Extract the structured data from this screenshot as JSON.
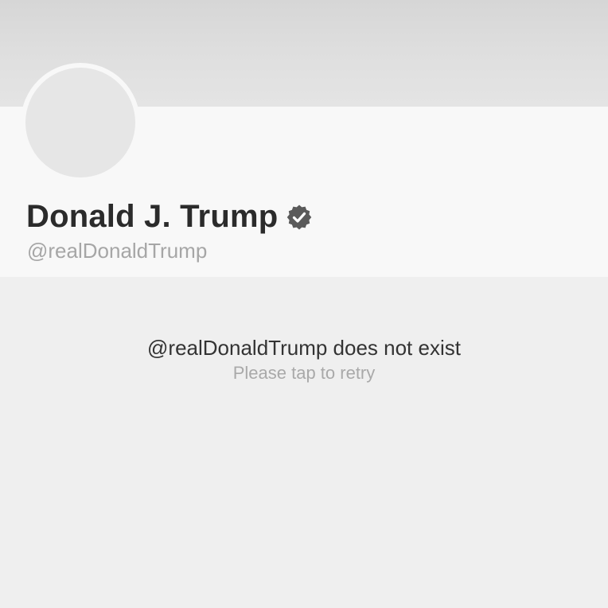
{
  "profile": {
    "display_name": "Donald J. Trump",
    "handle": "@realDonaldTrump",
    "verified_icon": "verified-badge-icon",
    "avatar_icon": "avatar-placeholder"
  },
  "error": {
    "title": "@realDonaldTrump does not exist",
    "subtitle": "Please tap to retry"
  },
  "colors": {
    "page_background": "#efefef",
    "card_background": "#f8f8f8",
    "banner": "#dcdcdc",
    "name_text": "#2b2b2b",
    "muted_text": "#a6a6a6",
    "badge": "#5a5a5a"
  }
}
